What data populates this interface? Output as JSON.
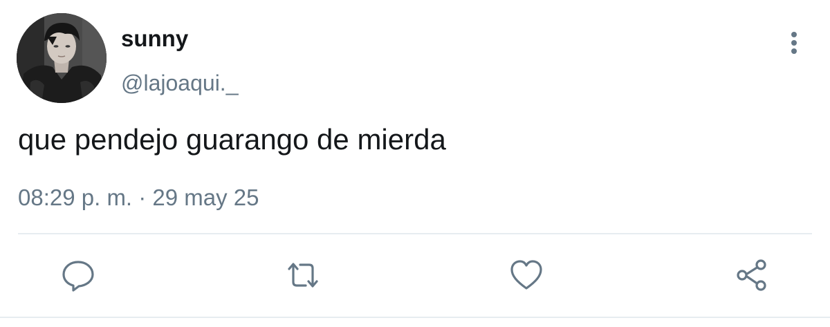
{
  "tweet": {
    "author": {
      "display_name": "sunny",
      "handle": "@lajoaqui._",
      "avatar_icon": "profile-photo"
    },
    "text": "que pendejo guarango de mierda",
    "timestamp": "08:29 p. m. · 29 may 25",
    "menu_icon": "more-vertical-icon"
  },
  "actions": [
    {
      "name": "reply",
      "icon": "speech-bubble-icon"
    },
    {
      "name": "retweet",
      "icon": "retweet-arrows-icon"
    },
    {
      "name": "like",
      "icon": "heart-icon"
    },
    {
      "name": "share",
      "icon": "share-nodes-icon"
    }
  ],
  "colors": {
    "primary_text": "#14171a",
    "secondary_text": "#657786",
    "icon": "#657786",
    "divider": "#e6ecf0",
    "background": "#ffffff"
  }
}
